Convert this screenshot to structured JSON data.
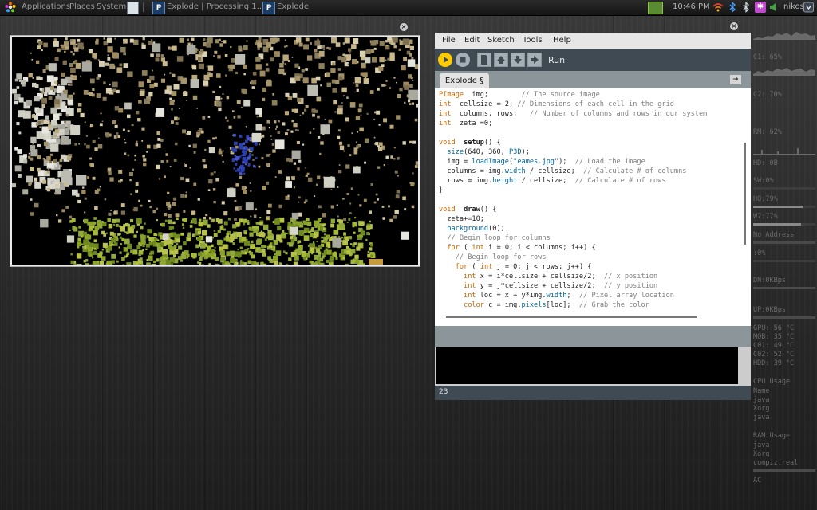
{
  "panel": {
    "menus": [
      "Applications",
      "Places",
      "System"
    ],
    "tasks": [
      "Explode | Processing 1...",
      "Explode"
    ],
    "clock": "10:46 PM",
    "user": "nikos"
  },
  "ide": {
    "menu": [
      "File",
      "Edit",
      "Sketch",
      "Tools",
      "Help"
    ],
    "run_label": "Run",
    "tab_label": "Explode §",
    "line_number": "23",
    "code": [
      [
        [
          "kw",
          "PImage"
        ],
        [
          "",
          "  img;        "
        ],
        [
          "cm",
          "// The source image"
        ]
      ],
      [
        [
          "kw",
          "int"
        ],
        [
          "",
          "  cellsize = 2; "
        ],
        [
          "cm",
          "// Dimensions of each cell in the grid"
        ]
      ],
      [
        [
          "kw",
          "int"
        ],
        [
          "",
          "  columns, rows;   "
        ],
        [
          "cm",
          "// Number of columns and rows in our system"
        ]
      ],
      [
        [
          "kw",
          "int"
        ],
        [
          "",
          "  zeta =0;"
        ]
      ],
      [],
      [
        [
          "kw",
          "void"
        ],
        [
          "",
          "  "
        ],
        [
          "bd",
          "setup"
        ],
        [
          "",
          "() {"
        ]
      ],
      [
        [
          "",
          "  "
        ],
        [
          "fn",
          "size"
        ],
        [
          "",
          "(640, 360, "
        ],
        [
          "st",
          "P3D"
        ],
        [
          "",
          ");"
        ]
      ],
      [
        [
          "",
          "  img = "
        ],
        [
          "fn",
          "loadImage"
        ],
        [
          "",
          "("
        ],
        [
          "st",
          "\"eames.jpg\""
        ],
        [
          "",
          ");  "
        ],
        [
          "cm",
          "// Load the image"
        ]
      ],
      [
        [
          "",
          "  columns = img."
        ],
        [
          "st",
          "width"
        ],
        [
          "",
          " / cellsize;  "
        ],
        [
          "cm",
          "// Calculate # of columns"
        ]
      ],
      [
        [
          "",
          "  rows = img."
        ],
        [
          "st",
          "height"
        ],
        [
          "",
          " / cellsize;  "
        ],
        [
          "cm",
          "// Calculate # of rows"
        ]
      ],
      [
        [
          "",
          "}"
        ]
      ],
      [],
      [
        [
          "kw",
          "void"
        ],
        [
          "",
          "  "
        ],
        [
          "bd",
          "draw"
        ],
        [
          "",
          "() {"
        ]
      ],
      [
        [
          "",
          "  zeta+=10;"
        ]
      ],
      [
        [
          "",
          "  "
        ],
        [
          "fn",
          "background"
        ],
        [
          "",
          "(0);"
        ]
      ],
      [
        [
          "",
          "  "
        ],
        [
          "cm",
          "// Begin loop for columns"
        ]
      ],
      [
        [
          "",
          "  "
        ],
        [
          "kw",
          "for"
        ],
        [
          "",
          " ( "
        ],
        [
          "kw",
          "int"
        ],
        [
          "",
          " i = 0; i < columns; i++) {"
        ]
      ],
      [
        [
          "",
          "    "
        ],
        [
          "cm",
          "// Begin loop for rows"
        ]
      ],
      [
        [
          "",
          "    "
        ],
        [
          "kw",
          "for"
        ],
        [
          "",
          " ( "
        ],
        [
          "kw",
          "int"
        ],
        [
          "",
          " j = 0; j < rows; j++) {"
        ]
      ],
      [
        [
          "",
          "      "
        ],
        [
          "kw",
          "int"
        ],
        [
          "",
          " x = i*cellsize + cellsize/2;  "
        ],
        [
          "cm",
          "// x position"
        ]
      ],
      [
        [
          "",
          "      "
        ],
        [
          "kw",
          "int"
        ],
        [
          "",
          " y = j*cellsize + cellsize/2;  "
        ],
        [
          "cm",
          "// y position"
        ]
      ],
      [
        [
          "",
          "      "
        ],
        [
          "kw",
          "int"
        ],
        [
          "",
          " loc = x + y*img."
        ],
        [
          "st",
          "width"
        ],
        [
          "",
          ";  "
        ],
        [
          "cm",
          "// Pixel array location"
        ]
      ],
      [
        [
          "",
          "      "
        ],
        [
          "kw",
          "color"
        ],
        [
          "",
          " c = img."
        ],
        [
          "st",
          "pixels"
        ],
        [
          "",
          "[loc];  "
        ],
        [
          "cm",
          "// Grab the color"
        ]
      ]
    ]
  },
  "conky": {
    "cpu1": "C1: 65%",
    "cpu1_level": 0.65,
    "cpu2": "C2: 70%",
    "cpu2_level": 0.7,
    "ram": "RM: 62%",
    "ram_level": 0.62,
    "hd": "HD: 0B",
    "sw": "SW:0%",
    "ho": "HO:79%",
    "ho_level": 0.79,
    "w7": "W7:77%",
    "w7_level": 0.77,
    "net": "No Address",
    "zero": ":0%",
    "dn": "DN:0KBps",
    "up": "UP:0KBps",
    "temps": [
      "GPU: 56 °C",
      "MOB: 35 °C",
      "C01: 49 °C",
      "C02: 52 °C",
      "HDD: 39 °C"
    ],
    "cpu_usage_title": "CPU Usage",
    "cpu_usage": [
      "Name",
      "java",
      "Xorg",
      "java"
    ],
    "ram_usage_title": "RAM Usage",
    "ram_usage": [
      "java",
      "Xorg",
      "compiz.real"
    ],
    "ac": "AC"
  }
}
